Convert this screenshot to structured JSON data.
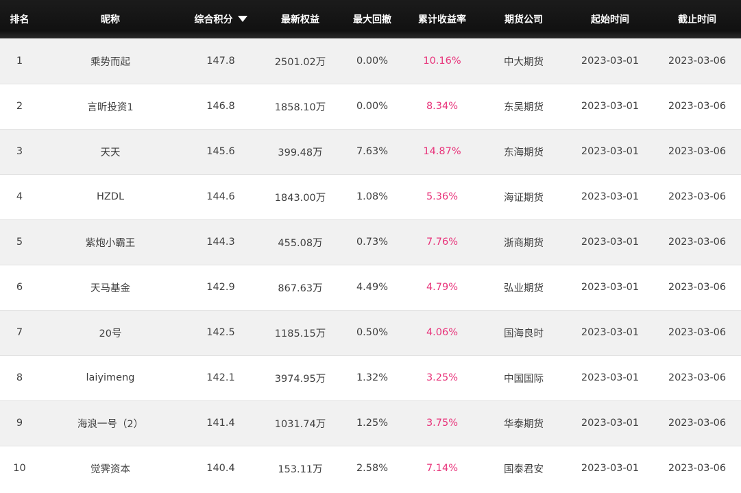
{
  "header": {
    "rank": "排名",
    "nickname": "昵称",
    "score": "综合积分",
    "equity": "最新权益",
    "drawdown": "最大回撤",
    "return": "累计收益率",
    "company": "期货公司",
    "start": "起始时间",
    "end": "截止时间"
  },
  "colors": {
    "header_bg": "#111111",
    "return_text": "#e8337a",
    "stripe": "#f1f1f1"
  },
  "rows": [
    {
      "rank": "1",
      "nickname": "乘势而起",
      "score": "147.8",
      "equity": "2501.02万",
      "drawdown": "0.00%",
      "return": "10.16%",
      "company": "中大期货",
      "start": "2023-03-01",
      "end": "2023-03-06"
    },
    {
      "rank": "2",
      "nickname": "言昕投资1",
      "score": "146.8",
      "equity": "1858.10万",
      "drawdown": "0.00%",
      "return": "8.34%",
      "company": "东吴期货",
      "start": "2023-03-01",
      "end": "2023-03-06"
    },
    {
      "rank": "3",
      "nickname": "天天",
      "score": "145.6",
      "equity": "399.48万",
      "drawdown": "7.63%",
      "return": "14.87%",
      "company": "东海期货",
      "start": "2023-03-01",
      "end": "2023-03-06"
    },
    {
      "rank": "4",
      "nickname": "HZDL",
      "score": "144.6",
      "equity": "1843.00万",
      "drawdown": "1.08%",
      "return": "5.36%",
      "company": "海证期货",
      "start": "2023-03-01",
      "end": "2023-03-06"
    },
    {
      "rank": "5",
      "nickname": "紫炮小霸王",
      "score": "144.3",
      "equity": "455.08万",
      "drawdown": "0.73%",
      "return": "7.76%",
      "company": "浙商期货",
      "start": "2023-03-01",
      "end": "2023-03-06"
    },
    {
      "rank": "6",
      "nickname": "天马基金",
      "score": "142.9",
      "equity": "867.63万",
      "drawdown": "4.49%",
      "return": "4.79%",
      "company": "弘业期货",
      "start": "2023-03-01",
      "end": "2023-03-06"
    },
    {
      "rank": "7",
      "nickname": "20号",
      "score": "142.5",
      "equity": "1185.15万",
      "drawdown": "0.50%",
      "return": "4.06%",
      "company": "国海良时",
      "start": "2023-03-01",
      "end": "2023-03-06"
    },
    {
      "rank": "8",
      "nickname": "laiyimeng",
      "score": "142.1",
      "equity": "3974.95万",
      "drawdown": "1.32%",
      "return": "3.25%",
      "company": "中国国际",
      "start": "2023-03-01",
      "end": "2023-03-06"
    },
    {
      "rank": "9",
      "nickname": "海浪一号（2）",
      "score": "141.4",
      "equity": "1031.74万",
      "drawdown": "1.25%",
      "return": "3.75%",
      "company": "华泰期货",
      "start": "2023-03-01",
      "end": "2023-03-06"
    },
    {
      "rank": "10",
      "nickname": "觉霁资本",
      "score": "140.4",
      "equity": "153.11万",
      "drawdown": "2.58%",
      "return": "7.14%",
      "company": "国泰君安",
      "start": "2023-03-01",
      "end": "2023-03-06"
    }
  ]
}
